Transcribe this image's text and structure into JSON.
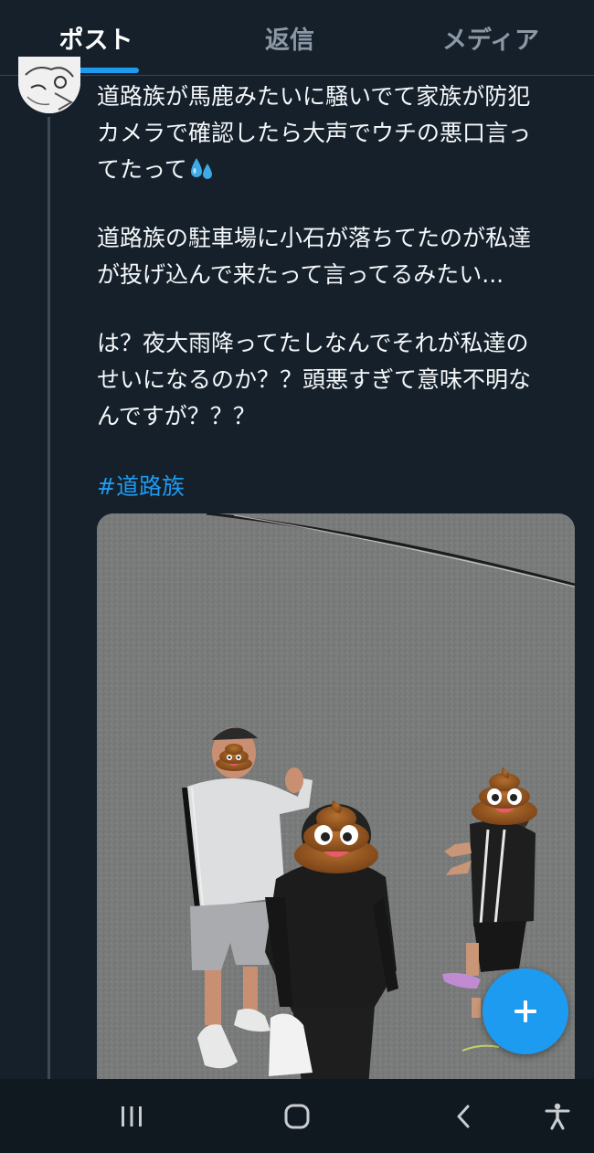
{
  "tabs": [
    {
      "label": "ポスト",
      "active": true
    },
    {
      "label": "返信",
      "active": false
    },
    {
      "label": "メディア",
      "active": false
    }
  ],
  "tweet": {
    "paragraph1": {
      "line1": "道路族が馬鹿みたいに騒いでて家族が防犯",
      "line2": "カメラで確認したら大声でウチの悪口言っ",
      "line3": "てたって",
      "emoji": "sweat-droplets-icon"
    },
    "paragraph2": {
      "line1": "道路族の駐車場に小石が落ちてたのが私達",
      "line2": "が投げ込んで来たって言ってるみたい..."
    },
    "paragraph3": {
      "line1": "は？夜大雨降ってたしなんでそれが私達の",
      "line2": "せいになるのか？？頭悪すぎて意味不明な",
      "line3": "んですが？？？"
    },
    "hashtag": "#道路族"
  },
  "fab": {
    "label": "+"
  },
  "navbar": {
    "items": [
      "recent-apps-icon",
      "home-icon",
      "back-icon",
      "accessibility-icon"
    ]
  },
  "colors": {
    "background": "#15202b",
    "accent": "#1d9bf0",
    "text": "#f5f8fa",
    "muted": "#8b98a5"
  }
}
